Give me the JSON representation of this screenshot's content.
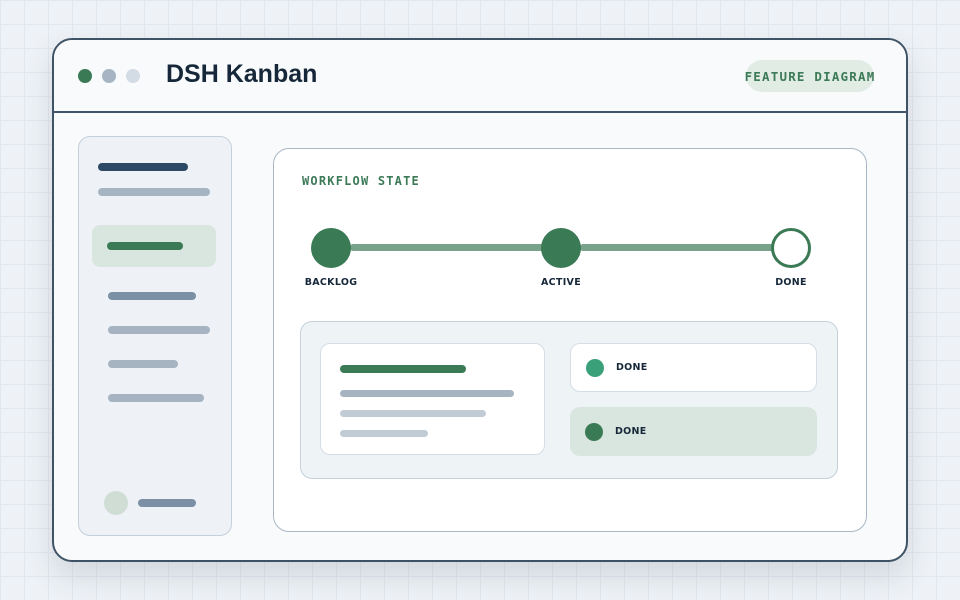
{
  "window": {
    "title": "DSH Kanban",
    "badge": "FEATURE DIAGRAM",
    "controls": [
      {
        "name": "window-dot-green",
        "color": "#3a7a55"
      },
      {
        "name": "window-dot-gray",
        "color": "#a7b4c3"
      },
      {
        "name": "window-dot-light",
        "color": "#d3dbe4"
      }
    ]
  },
  "colors": {
    "accent": "#3a7a55",
    "accent_light": "#d9e6e0",
    "connector": "#78a38a",
    "status_done_dot": "#3aa07a",
    "text_dark": "#16273a"
  },
  "workflow": {
    "label": "WORKFLOW STATE",
    "steps": [
      {
        "label": "BACKLOG",
        "state": "filled"
      },
      {
        "label": "ACTIVE",
        "state": "filled"
      },
      {
        "label": "DONE",
        "state": "hollow"
      }
    ]
  },
  "status_list": [
    {
      "label": "DONE",
      "dot_color": "#3aa07a",
      "highlighted": false
    },
    {
      "label": "DONE",
      "dot_color": "#3a7a55",
      "highlighted": true
    }
  ]
}
